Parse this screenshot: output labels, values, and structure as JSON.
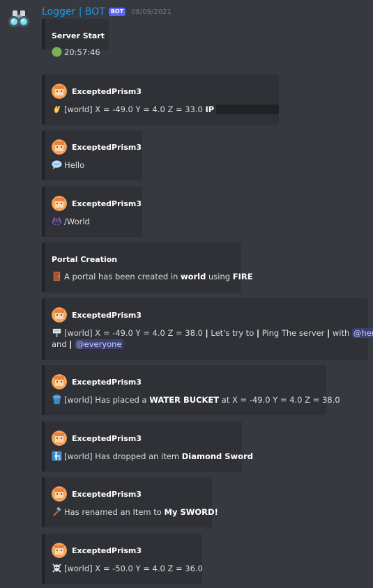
{
  "message": {
    "username": "Logger | BOT",
    "bot_tag": "BOT",
    "timestamp": "08/09/2021"
  },
  "embeds": [
    {
      "type": "title",
      "title": "Server Start",
      "time": "20:57:46",
      "icon": "green-circle-icon"
    },
    {
      "type": "author",
      "author": "ExceptedPrism3",
      "icon": "waving-hand-icon",
      "text": "[world] X = -49.0 Y = 4.0 Z = 33.0 ",
      "bold": "IP"
    },
    {
      "type": "author",
      "author": "ExceptedPrism3",
      "icon": "speech-bubble-icon",
      "text": "Hello"
    },
    {
      "type": "author",
      "author": "ExceptedPrism3",
      "icon": "space-invader-icon",
      "text": "/World"
    },
    {
      "type": "title",
      "title": "Portal Creation",
      "icon": "door-icon",
      "pre": "A portal has been created in ",
      "bold1": "world",
      "mid": " using ",
      "bold2": "FIRE"
    },
    {
      "type": "author",
      "author": "ExceptedPrism3",
      "icon": "signpost-icon",
      "line1_a": "[world] X = -49.0 Y = 4.0 Z = 38.0 ",
      "sep": "|",
      "line1_b": " Let's try to ",
      "line1_c": " Ping The server ",
      "line1_d": " with ",
      "mention1": "@here",
      "line2_a": "and ",
      "mention2": "@everyone"
    },
    {
      "type": "author",
      "author": "ExceptedPrism3",
      "icon": "water-bucket-icon",
      "pre": "[world] Has placed a ",
      "bold": "WATER BUCKET",
      "post": " at X = -49.0 Y = 4.0 Z = 38.0"
    },
    {
      "type": "author",
      "author": "ExceptedPrism3",
      "icon": "person-drop-icon",
      "pre": "[world] Has dropped an item ",
      "bold": "Diamond Sword"
    },
    {
      "type": "author",
      "author": "ExceptedPrism3",
      "icon": "hammer-icon",
      "pre": "Has renamed an Item to ",
      "bold": "My SWORD!"
    },
    {
      "type": "author",
      "author": "ExceptedPrism3",
      "icon": "skull-crossbones-icon",
      "text": "[world] X = -50.0 Y = 4.0 Z = 36.0"
    }
  ]
}
